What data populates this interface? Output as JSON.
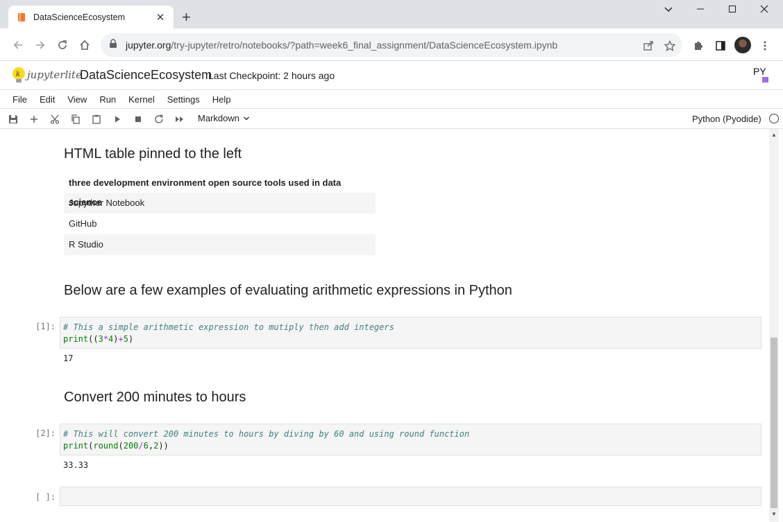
{
  "browser": {
    "tab_title": "DataScienceEcosystem",
    "tab_close": "✕",
    "new_tab": "+",
    "url_host": "jupyter.org",
    "url_path": "/try-jupyter/retro/notebooks/?path=week6_final_assignment/DataScienceEcosystem.ipynb",
    "window_controls": {
      "dropdown": "⌄",
      "minimize": "—",
      "maximize": "☐",
      "close": "✕"
    }
  },
  "header": {
    "logo_text": "jupyterlite",
    "notebook_title": "DataScienceEcosystem",
    "checkpoint": "Last Checkpoint: 2 hours ago",
    "py_logo": "PY"
  },
  "menu": [
    "File",
    "Edit",
    "View",
    "Run",
    "Kernel",
    "Settings",
    "Help"
  ],
  "toolbar": {
    "cell_type": "Markdown",
    "kernel": "Python (Pyodide)"
  },
  "notebook": {
    "heading_table": "HTML table pinned to the left",
    "table": {
      "header": "three development environment open source tools used in data science",
      "rows": [
        "Jupyther Notebook",
        "GitHub",
        "R Studio"
      ]
    },
    "heading_arith": "Below are a few examples of evaluating arithmetic expressions in Python",
    "cell1": {
      "prompt": "[1]:",
      "comment": "#  This a simple arithmetic expression to mutiply then add integers",
      "output": "17"
    },
    "heading_convert": "Convert 200 minutes to hours",
    "cell2": {
      "prompt": "[2]:",
      "comment": "# This will convert 200 minutes to hours by diving by 60 and using round function",
      "output": "33.33"
    },
    "cell3": {
      "prompt": "[ ]:"
    }
  },
  "colors": {
    "tabbar": "#dee1e6",
    "omnibox": "#f1f3f4",
    "code_bg": "#f5f5f5",
    "comment": "#408080",
    "keyword": "#008000",
    "operator": "#aa22ff"
  }
}
